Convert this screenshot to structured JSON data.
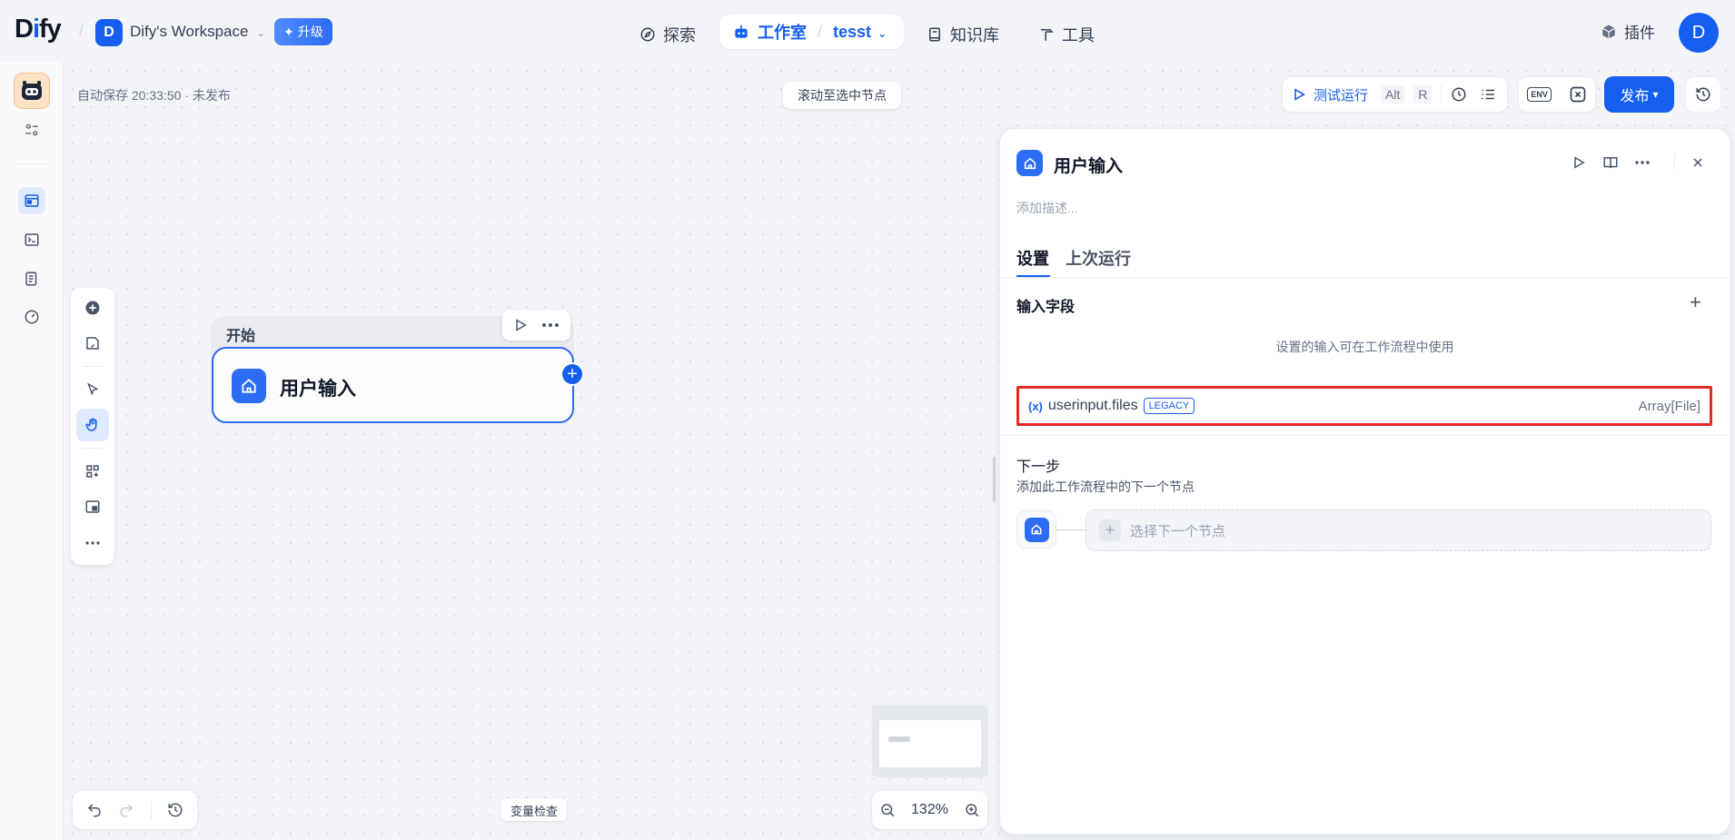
{
  "nav": {
    "logo_prefix": "D",
    "logo_dot": "i",
    "logo_suffix": "fy",
    "workspace_initial": "D",
    "workspace_name": "Dify's Workspace",
    "upgrade_label": "升级",
    "explore": "探索",
    "studio": "工作室",
    "app_name": "tesst",
    "knowledge": "知识库",
    "tools": "工具",
    "plugins": "插件",
    "user_initial": "D"
  },
  "workflow": {
    "autosave": "自动保存 20:33:50 · 未发布",
    "scroll_to_node": "滚动至选中节点",
    "test_run": "测试运行",
    "shortcut_alt": "Alt",
    "shortcut_r": "R",
    "env_label": "ENV",
    "publish": "发布"
  },
  "node": {
    "group_title": "开始",
    "label": "用户输入"
  },
  "bottom": {
    "variable_check": "变量检查",
    "zoom": "132%"
  },
  "panel": {
    "title": "用户输入",
    "description_placeholder": "添加描述...",
    "tabs": [
      "设置",
      "上次运行"
    ],
    "input_fields_title": "输入字段",
    "input_fields_help": "设置的输入可在工作流程中使用",
    "variable": {
      "symbol": "(x)",
      "name": "userinput.files",
      "badge": "LEGACY",
      "type": "Array[File]"
    },
    "next_step_title": "下一步",
    "next_step_desc": "添加此工作流程中的下一个节点",
    "select_next": "选择下一个节点"
  },
  "colors": {
    "accent": "#155eef",
    "highlight_border": "#e42a20"
  }
}
